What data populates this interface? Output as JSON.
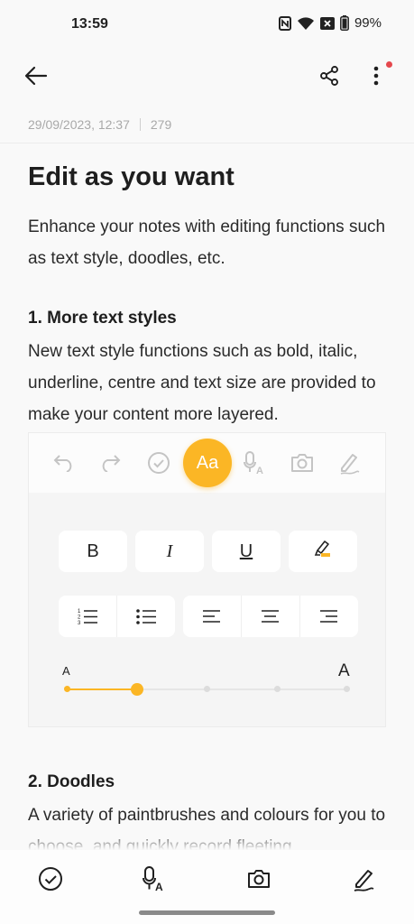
{
  "status_bar": {
    "time": "13:59",
    "battery": "99%",
    "icons": [
      "nfc-icon",
      "wifi-icon",
      "no-sim-icon",
      "battery-icon"
    ]
  },
  "app_bar": {
    "icons": [
      "back-arrow-icon",
      "share-icon",
      "more-vertical-icon"
    ],
    "has_notification_dot": true
  },
  "note": {
    "date": "29/09/2023, 12:37",
    "char_count": "279",
    "title": "Edit as you want",
    "intro": "Enhance your notes with editing functions such as text style, doodles, etc.",
    "section1_heading": "1. More text styles",
    "section1_body": "New text style functions such as bold, italic, underline, centre and text size are provided to make your content more layered.",
    "section2_heading": "2. Doodles",
    "section2_body": "A variety of paintbrushes and colours for you to choose, and quickly record fleeting"
  },
  "editor_preview": {
    "toolbar_icons": [
      "undo-icon",
      "redo-icon",
      "checklist-icon",
      "text-style-icon",
      "voice-to-text-icon",
      "camera-icon",
      "doodle-pen-icon"
    ],
    "active_tool_label": "Aa",
    "format_buttons": {
      "bold": "B",
      "italic": "I",
      "underline": "U",
      "highlight_icon": "highlighter-icon"
    },
    "list_icons": [
      "numbered-list-icon",
      "bulleted-list-icon"
    ],
    "align_icons": [
      "align-left-icon",
      "align-center-icon",
      "align-right-icon"
    ],
    "text_size": {
      "min_label": "A",
      "max_label": "A",
      "steps": 5,
      "selected_step": 2
    },
    "accent_color": "#fbb625"
  },
  "bottom_toolbar": {
    "icons": [
      "checklist-icon",
      "voice-to-text-icon",
      "camera-icon",
      "doodle-pen-icon"
    ]
  }
}
